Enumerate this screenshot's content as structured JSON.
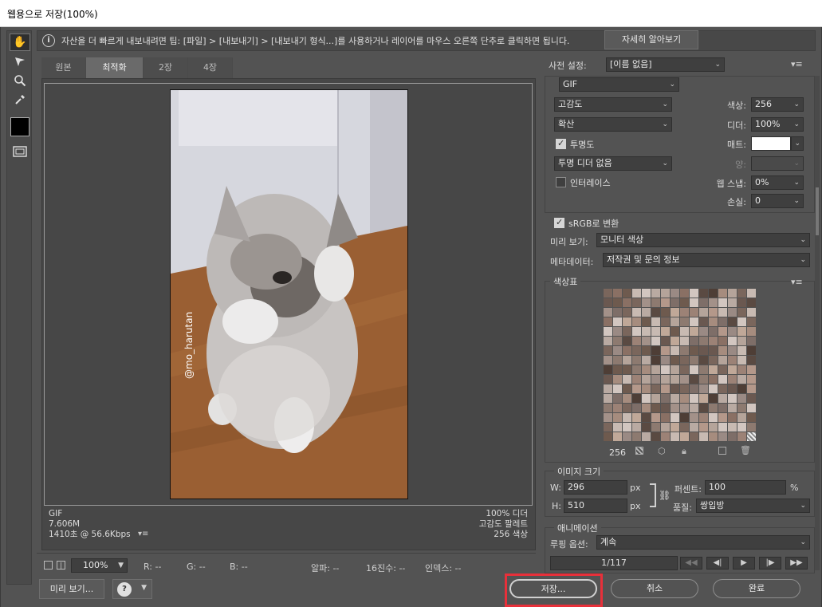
{
  "window": {
    "title": "웹용으로 저장(100%)"
  },
  "infobar": {
    "message": "자산을 더 빠르게 내보내려면 팁: [파일] > [내보내기] > [내보내기 형식...]를 사용하거나 레이어를 마우스 오른쪽 단추로 클릭하면 됩니다.",
    "learn_more": "자세히 알아보기"
  },
  "tabs": [
    "원본",
    "최적화",
    "2장",
    "4장"
  ],
  "image": {
    "watermark": "@mo_harutan"
  },
  "stats_left": {
    "format": "GIF",
    "size": "7.606M",
    "time": "1410초 @ 56.6Kbps"
  },
  "stats_right": {
    "dither": "100% 디더",
    "palette": "고감도 팔레트",
    "colors": "256 색상"
  },
  "status": {
    "zoom": "100%",
    "r": "R: --",
    "g": "G: --",
    "b": "B: --",
    "alpha": "알파: --",
    "hex": "16진수: --",
    "index": "인덱스: --"
  },
  "preset": {
    "label": "사전 설정:",
    "value": "[이름 없음]",
    "format": "GIF",
    "reduction": "고감도",
    "dither_algo": "확산",
    "transparency_label": "투명도",
    "transparency_checked": true,
    "trans_dither": "투명 디더 없음",
    "interlace_label": "인터레이스",
    "interlace_checked": false,
    "colors_label": "색상:",
    "colors_value": "256",
    "dither_label": "디더:",
    "dither_value": "100%",
    "matte_label": "매트:",
    "amount_label": "양:",
    "web_snap_label": "웹 스냅:",
    "web_snap_value": "0%",
    "lossy_label": "손실:",
    "lossy_value": "0",
    "srgb_label": "sRGB로 변환",
    "srgb_checked": true,
    "preview_label": "미리 보기:",
    "preview_value": "모니터 색상",
    "metadata_label": "메타데이터:",
    "metadata_value": "저작권 및 문의 정보"
  },
  "color_table": {
    "title": "색상표",
    "count": "256"
  },
  "image_size": {
    "title": "이미지 크기",
    "w_label": "W:",
    "w_value": "296",
    "h_label": "H:",
    "h_value": "510",
    "unit": "px",
    "percent_label": "퍼센트:",
    "percent_value": "100",
    "percent_unit": "%",
    "quality_label": "품질:",
    "quality_value": "쌍입방"
  },
  "animation": {
    "title": "애니메이션",
    "loop_label": "루핑 옵션:",
    "loop_value": "계속",
    "frame": "1/117"
  },
  "buttons": {
    "preview": "미리 보기...",
    "save": "저장...",
    "cancel": "취소",
    "done": "완료"
  },
  "colors": {
    "accent_highlight": "#e8303a",
    "panel_bg": "#535353"
  }
}
